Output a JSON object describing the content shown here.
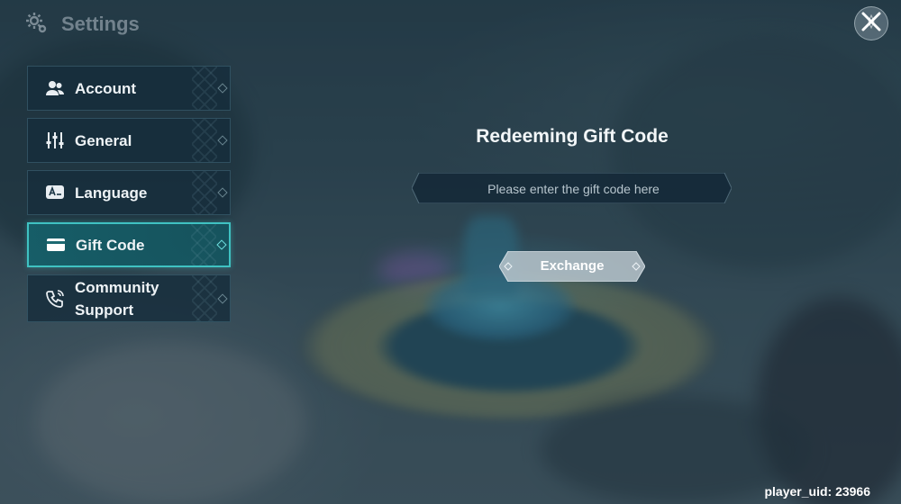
{
  "header": {
    "title": "Settings",
    "icon": "gear-icon"
  },
  "close_icon": "close-icon",
  "sidebar": {
    "items": [
      {
        "label": "Account",
        "icon": "users-icon",
        "active": false
      },
      {
        "label": "General",
        "icon": "sliders-icon",
        "active": false
      },
      {
        "label": "Language",
        "icon": "language-icon",
        "active": false
      },
      {
        "label": "Gift Code",
        "icon": "card-icon",
        "active": true
      },
      {
        "label": "Community Support",
        "icon": "phone-icon",
        "active": false
      }
    ]
  },
  "main": {
    "title": "Redeeming Gift Code",
    "input_value": "",
    "input_placeholder": "Please enter the gift code here",
    "exchange_label": "Exchange"
  },
  "footer": {
    "uid": "player_uid: 23966"
  },
  "colors": {
    "accent": "#3fc2c2",
    "panel": "#162d3c",
    "button": "#b9c6cc"
  }
}
